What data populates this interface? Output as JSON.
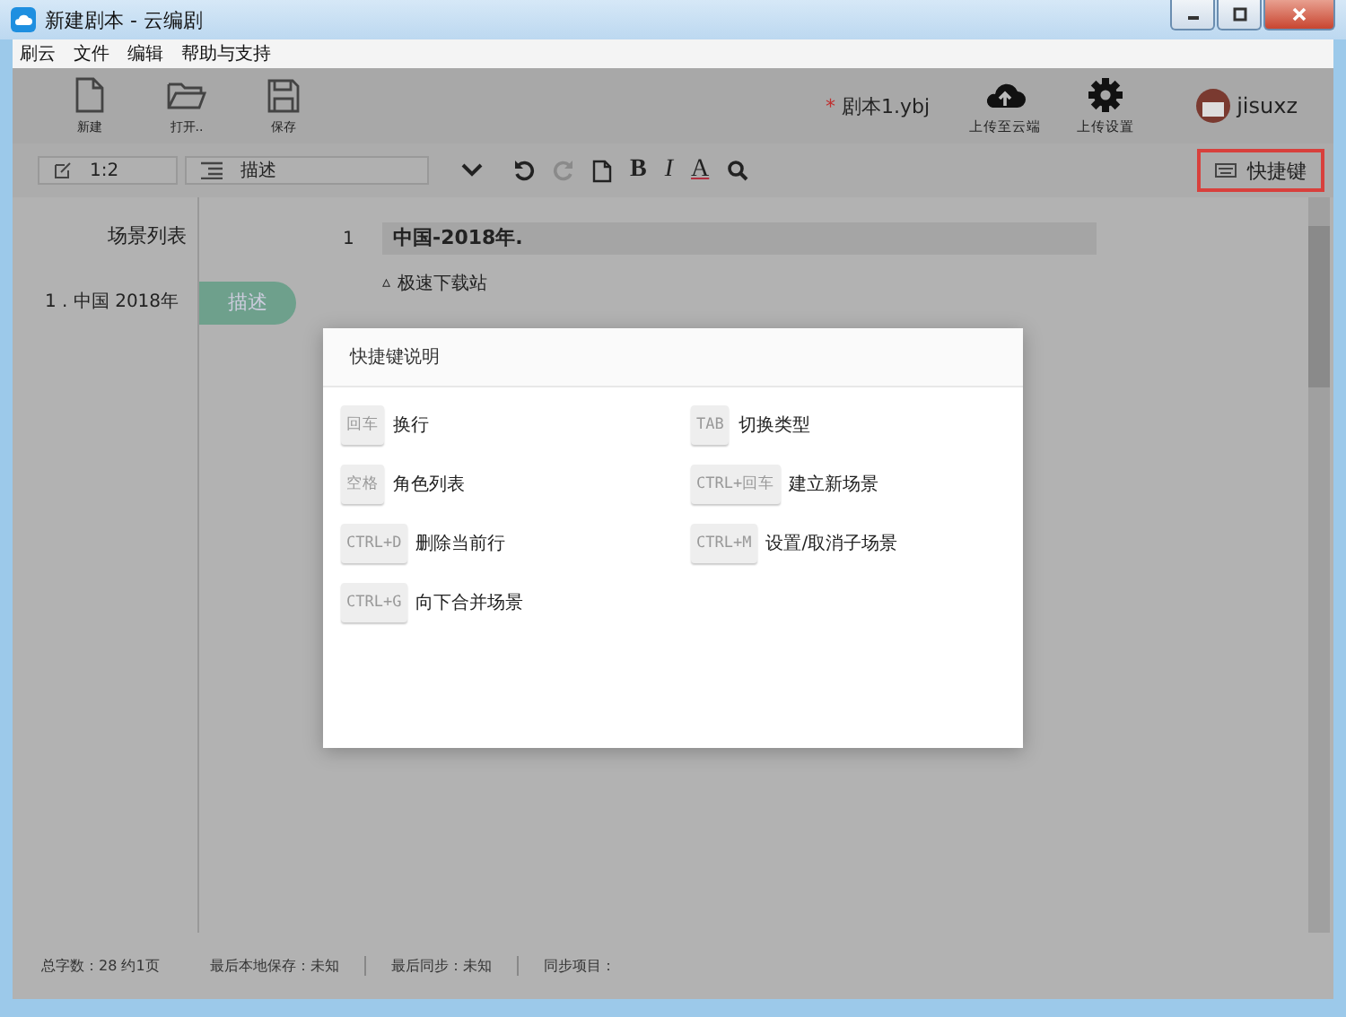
{
  "window": {
    "title": "新建剧本 - 云编剧"
  },
  "menu": [
    "刷云",
    "文件",
    "编辑",
    "帮助与支持"
  ],
  "toolbar": {
    "left": [
      {
        "label": "新建"
      },
      {
        "label": "打开.."
      },
      {
        "label": "保存"
      }
    ],
    "document": {
      "modified_mark": "*",
      "name": "剧本1.ybj"
    },
    "right": [
      {
        "label": "上传至云端"
      },
      {
        "label": "上传设置"
      }
    ],
    "user": {
      "name": "jisuxz"
    }
  },
  "format_bar": {
    "position": "1:2",
    "type": "描述",
    "tools": [
      {
        "kind": "undo",
        "disabled": false
      },
      {
        "kind": "redo",
        "disabled": true
      },
      {
        "kind": "page",
        "disabled": false
      },
      {
        "kind": "bold",
        "label": "B",
        "disabled": false
      },
      {
        "kind": "italic",
        "label": "I",
        "disabled": false
      },
      {
        "kind": "color",
        "label": "A",
        "disabled": false
      },
      {
        "kind": "search",
        "disabled": false
      }
    ],
    "shortcut_button": {
      "label": "快捷键",
      "highlighted": true
    }
  },
  "sidebar": {
    "title": "场景列表",
    "scenes": [
      "1 . 中国 2018年"
    ]
  },
  "type_tag": "描述",
  "editor": {
    "lines": [
      {
        "kind": "scene",
        "number": "1",
        "text": "中国-2018年."
      },
      {
        "kind": "action",
        "marker": "▵",
        "text": "极速下载站"
      }
    ]
  },
  "dialog": {
    "title": "快捷键说明",
    "shortcuts": [
      {
        "key": "回车",
        "action": "换行"
      },
      {
        "key": "TAB",
        "action": "切换类型"
      },
      {
        "key": "空格",
        "action": "角色列表"
      },
      {
        "key": "CTRL+回车",
        "action": "建立新场景"
      },
      {
        "key": "CTRL+D",
        "action": "删除当前行"
      },
      {
        "key": "CTRL+M",
        "action": "设置/取消子场景"
      },
      {
        "key": "CTRL+G",
        "action": "向下合并场景"
      }
    ]
  },
  "status_bar": [
    "总字数：28 约1页",
    "最后本地保存：未知",
    "最后同步：未知",
    "同步项目："
  ]
}
